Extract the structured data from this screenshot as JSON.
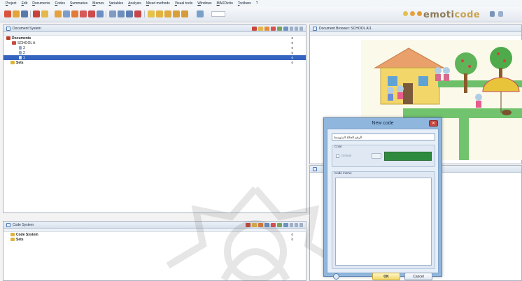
{
  "menu": [
    "Project",
    "Edit",
    "Documents",
    "Codes",
    "Summaries",
    "Memos",
    "Variables",
    "Analysis",
    "Mixed methods",
    "Visual tools",
    "Windows",
    "MAXDictio",
    "Toolbars",
    "?"
  ],
  "logo": {
    "text_main": "emoti",
    "text_accent": "code"
  },
  "document_system": {
    "title": "Document System",
    "root": {
      "label": "Documents",
      "count": "0"
    },
    "group": {
      "label": "SCHOOL A",
      "count": "0"
    },
    "docs": [
      {
        "label": "3",
        "count": "0"
      },
      {
        "label": "2",
        "count": "0"
      },
      {
        "label": "1",
        "count": "0"
      }
    ],
    "sets": {
      "label": "Sets",
      "count": "0"
    }
  },
  "code_system": {
    "title": "Code System",
    "root": {
      "label": "Code System",
      "count": "0"
    },
    "sets": {
      "label": "Sets",
      "count": "0"
    }
  },
  "document_browser": {
    "title": "Document Browser: SCHOOL A\\1"
  },
  "new_code_dialog": {
    "title": "New code",
    "code_name_value": "الرقم الجالة المتوسط",
    "color_label": "Color",
    "default_label": "Default",
    "color_value": "#2e8b3e",
    "memo_label": "Code memo",
    "ok_label": "OK",
    "cancel_label": "Cancel"
  },
  "colors": {
    "selection": "#3564c0",
    "dialog_frame": "#8fb6dc",
    "pane_header": "#d7e1ed"
  }
}
